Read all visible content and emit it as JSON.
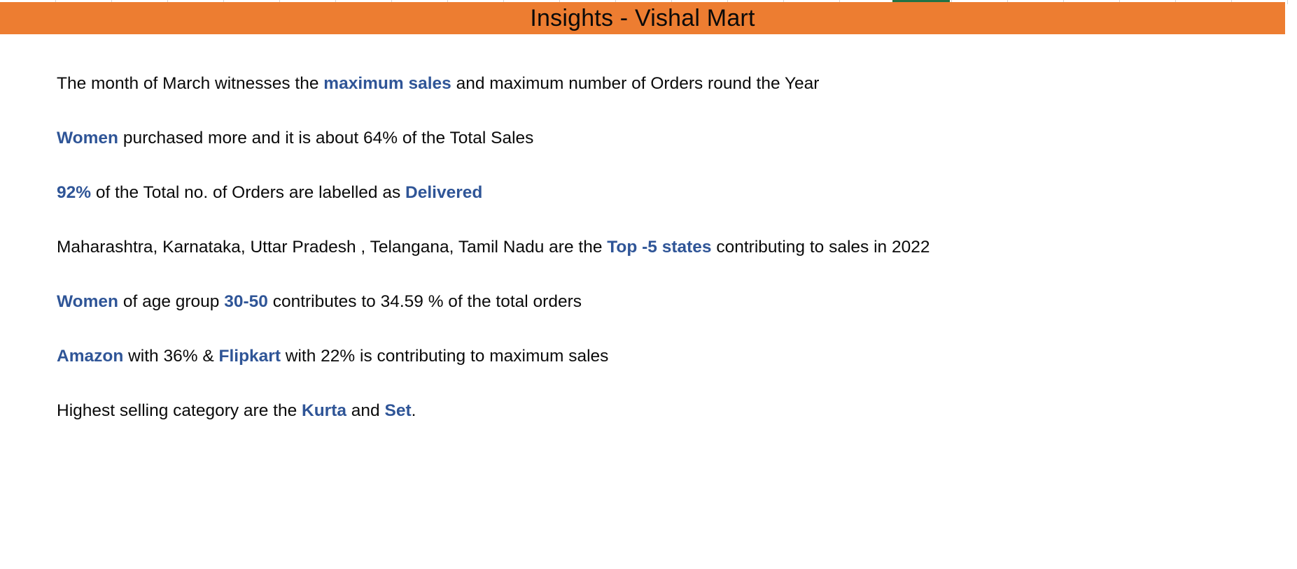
{
  "title": "Insights - Vishal Mart",
  "colors": {
    "title_bar": "#ed7d31",
    "highlight": "#2f5597",
    "body_text": "#0a0a0a",
    "selected_column": "#217346"
  },
  "insights": [
    {
      "segments": [
        {
          "text": "The month of March witnesses the ",
          "bold": false
        },
        {
          "text": "maximum sales",
          "bold": true
        },
        {
          "text": " and maximum number of Orders round the Year",
          "bold": false
        }
      ]
    },
    {
      "segments": [
        {
          "text": "Women",
          "bold": true
        },
        {
          "text": " purchased more and it is about 64% of the Total Sales",
          "bold": false
        }
      ]
    },
    {
      "segments": [
        {
          "text": "92%",
          "bold": true
        },
        {
          "text": " of the Total no. of Orders are labelled as ",
          "bold": false
        },
        {
          "text": "Delivered",
          "bold": true
        }
      ]
    },
    {
      "segments": [
        {
          "text": "Maharashtra, Karnataka, Uttar Pradesh , Telangana, Tamil Nadu are the ",
          "bold": false
        },
        {
          "text": "Top -5 states",
          "bold": true
        },
        {
          "text": " contributing to sales in 2022",
          "bold": false
        }
      ]
    },
    {
      "segments": [
        {
          "text": "Women",
          "bold": true
        },
        {
          "text": " of age group ",
          "bold": false
        },
        {
          "text": "30-50",
          "bold": true
        },
        {
          "text": " contributes to 34.59 % of the total orders",
          "bold": false
        }
      ]
    },
    {
      "segments": [
        {
          "text": "Amazon",
          "bold": true
        },
        {
          "text": " with 36% & ",
          "bold": false
        },
        {
          "text": "Flipkart",
          "bold": true
        },
        {
          "text": " with 22% is contributing to maximum sales",
          "bold": false
        }
      ]
    },
    {
      "segments": [
        {
          "text": "Highest selling category are the ",
          "bold": false
        },
        {
          "text": "Kurta",
          "bold": true
        },
        {
          "text": " and ",
          "bold": false
        },
        {
          "text": "Set",
          "bold": true
        },
        {
          "text": ".",
          "bold": false
        }
      ]
    }
  ]
}
